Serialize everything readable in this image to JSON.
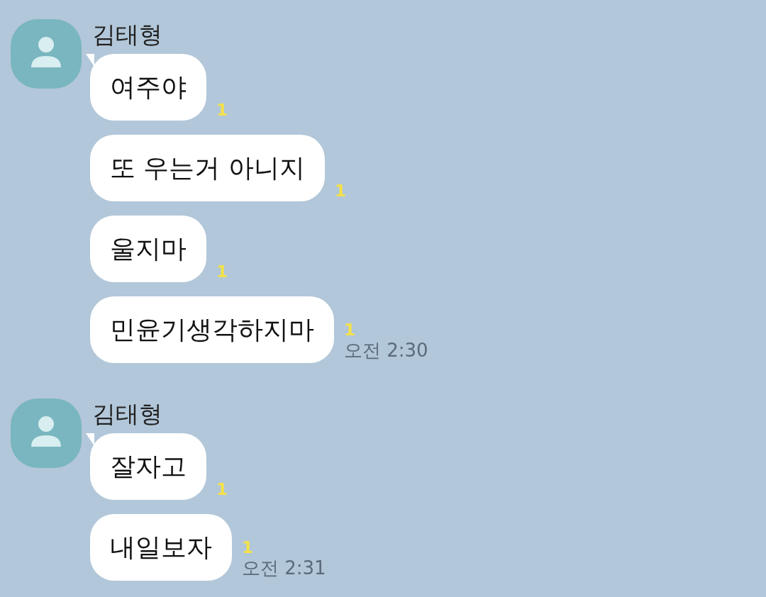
{
  "groups": [
    {
      "sender": "김태형",
      "messages": [
        {
          "text": "여주야",
          "unread": "1"
        },
        {
          "text": "또 우는거 아니지",
          "unread": "1"
        },
        {
          "text": "울지마",
          "unread": "1"
        },
        {
          "text": "민윤기생각하지마",
          "unread": "1",
          "time": "오전 2:30"
        }
      ]
    },
    {
      "sender": "김태형",
      "messages": [
        {
          "text": "잘자고",
          "unread": "1"
        },
        {
          "text": "내일보자",
          "unread": "1",
          "time": "오전 2:31"
        }
      ]
    }
  ]
}
